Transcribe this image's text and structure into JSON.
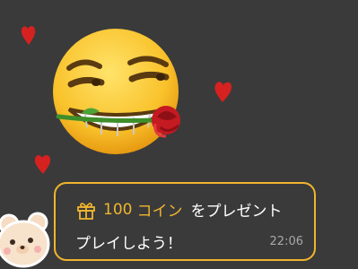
{
  "message": {
    "amount": "100",
    "coin_label": "コイン",
    "action_text": "をプレゼント",
    "second_line": "プレイしよう！",
    "timestamp": "22:06"
  },
  "icons": {
    "gift": "gift-icon",
    "emoji": "smirking-face-with-rose-emoji",
    "bear": "bear-sticker",
    "hearts": "heart-icon"
  },
  "colors": {
    "background": "#3a3a3a",
    "accent": "#f0b52e",
    "heart": "#d62121",
    "text": "#ffffff",
    "timestamp": "#a8a8a8"
  }
}
